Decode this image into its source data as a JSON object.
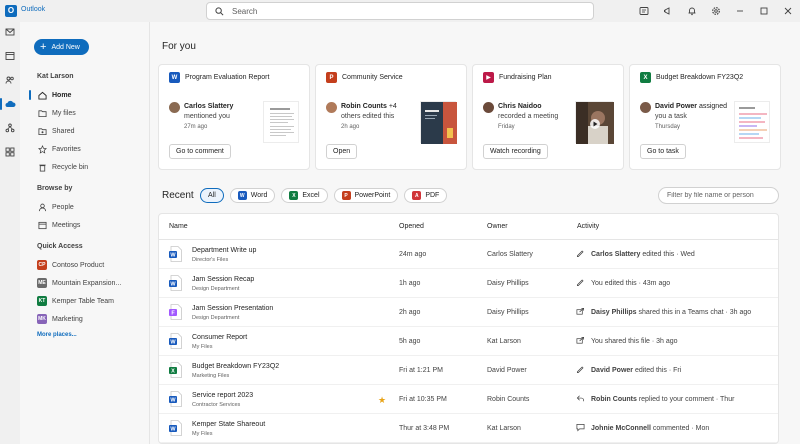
{
  "app": {
    "name": "Outlook",
    "logo_letter": "O"
  },
  "search": {
    "placeholder": "Search"
  },
  "sidebar": {
    "add_new": "Add New",
    "user": "Kat Larson",
    "items": [
      {
        "label": "Home",
        "icon": "home-icon"
      },
      {
        "label": "My files",
        "icon": "folder-icon"
      },
      {
        "label": "Shared",
        "icon": "shared-icon"
      },
      {
        "label": "Favorites",
        "icon": "star-icon"
      },
      {
        "label": "Recycle bin",
        "icon": "trash-icon"
      }
    ],
    "browse_by": "Browse by",
    "browse_items": [
      {
        "label": "People",
        "icon": "person-icon"
      },
      {
        "label": "Meetings",
        "icon": "calendar-icon"
      }
    ],
    "quick_access": "Quick Access",
    "quick_items": [
      {
        "label": "Contoso Product",
        "abbr": "CP",
        "color": "#c43e1c"
      },
      {
        "label": "Mountain Expansion...",
        "abbr": "ME",
        "color": "#6b6b6b"
      },
      {
        "label": "Kemper Table Team",
        "abbr": "KT",
        "color": "#107c41"
      },
      {
        "label": "Marketing",
        "abbr": "MK",
        "color": "#8764b8"
      }
    ],
    "more_places": "More places..."
  },
  "for_you": {
    "title": "For you",
    "cards": [
      {
        "file": "Program Evaluation Report",
        "type": "word",
        "person": "Carlos Slattery",
        "action_suffix": "",
        "action": "mentioned you",
        "time": "27m ago",
        "button": "Go to comment"
      },
      {
        "file": "Community Service",
        "type": "powerpoint",
        "person": "Robin Counts",
        "action_suffix": " +4",
        "action": "others edited this",
        "time": "2h ago",
        "button": "Open"
      },
      {
        "file": "Fundraising Plan",
        "type": "stream",
        "person": "Chris Naidoo",
        "action_suffix": "",
        "action": "recorded a meeting",
        "time": "Friday",
        "button": "Watch recording"
      },
      {
        "file": "Budget Breakdown FY23Q2",
        "type": "excel",
        "person": "David Power",
        "action_suffix": " assigned",
        "action": "you a task",
        "time": "Thursday",
        "button": "Go to task"
      }
    ]
  },
  "recent": {
    "title": "Recent",
    "filters": [
      {
        "label": "All",
        "type": ""
      },
      {
        "label": "Word",
        "type": "word"
      },
      {
        "label": "Excel",
        "type": "excel"
      },
      {
        "label": "PowerPoint",
        "type": "powerpoint"
      },
      {
        "label": "PDF",
        "type": "pdf"
      }
    ],
    "filter_placeholder": "Filter by file name or person",
    "columns": {
      "name": "Name",
      "opened": "Opened",
      "owner": "Owner",
      "activity": "Activity"
    },
    "rows": [
      {
        "name": "Department Write up",
        "location": "Director's Files",
        "type": "word",
        "opened": "24m ago",
        "owner": "Carlos Slattery",
        "act_person": "Carlos Slattery",
        "act_text": " edited this · Wed",
        "act_icon": "edit-icon",
        "starred": false
      },
      {
        "name": "Jam Session Recap",
        "location": "Design Department",
        "type": "word",
        "opened": "1h ago",
        "owner": "Daisy Phillips",
        "act_person": "",
        "act_text": "You edited this · 43m ago",
        "act_icon": "edit-icon",
        "starred": false
      },
      {
        "name": "Jam Session Presentation",
        "location": "Design Department",
        "type": "figma",
        "opened": "2h ago",
        "owner": "Daisy Phillips",
        "act_person": "Daisy Phillips",
        "act_text": " shared this in a Teams chat · 3h ago",
        "act_icon": "share-icon",
        "starred": false
      },
      {
        "name": "Consumer Report",
        "location": "My Files",
        "type": "word",
        "opened": "5h ago",
        "owner": "Kat Larson",
        "act_person": "",
        "act_text": "You shared this file · 3h ago",
        "act_icon": "share-icon",
        "starred": false
      },
      {
        "name": "Budget Breakdown FY23Q2",
        "location": "Marketing Files",
        "type": "excel",
        "opened": "Fri at 1:21 PM",
        "owner": "David Power",
        "act_person": "David Power",
        "act_text": " edited this · Fri",
        "act_icon": "edit-icon",
        "starred": false
      },
      {
        "name": "Service report 2023",
        "location": "Contractor Services",
        "type": "word",
        "opened": "Fri at 10:35 PM",
        "owner": "Robin Counts",
        "act_person": "Robin Counts",
        "act_text": " replied to your comment · Thur",
        "act_icon": "reply-icon",
        "starred": true
      },
      {
        "name": "Kemper State Shareout",
        "location": "My Files",
        "type": "word",
        "opened": "Thur at 3:48 PM",
        "owner": "Kat Larson",
        "act_person": "Johnie McConnell",
        "act_text": " commented · Mon",
        "act_icon": "comment-icon",
        "starred": false
      }
    ]
  },
  "colors": {
    "accent": "#0f6cbd",
    "word": "#185abd",
    "excel": "#107c41",
    "powerpoint": "#c43e1c",
    "pdf": "#d13438",
    "stream": "#bc1948",
    "figma": "#a259ff"
  }
}
